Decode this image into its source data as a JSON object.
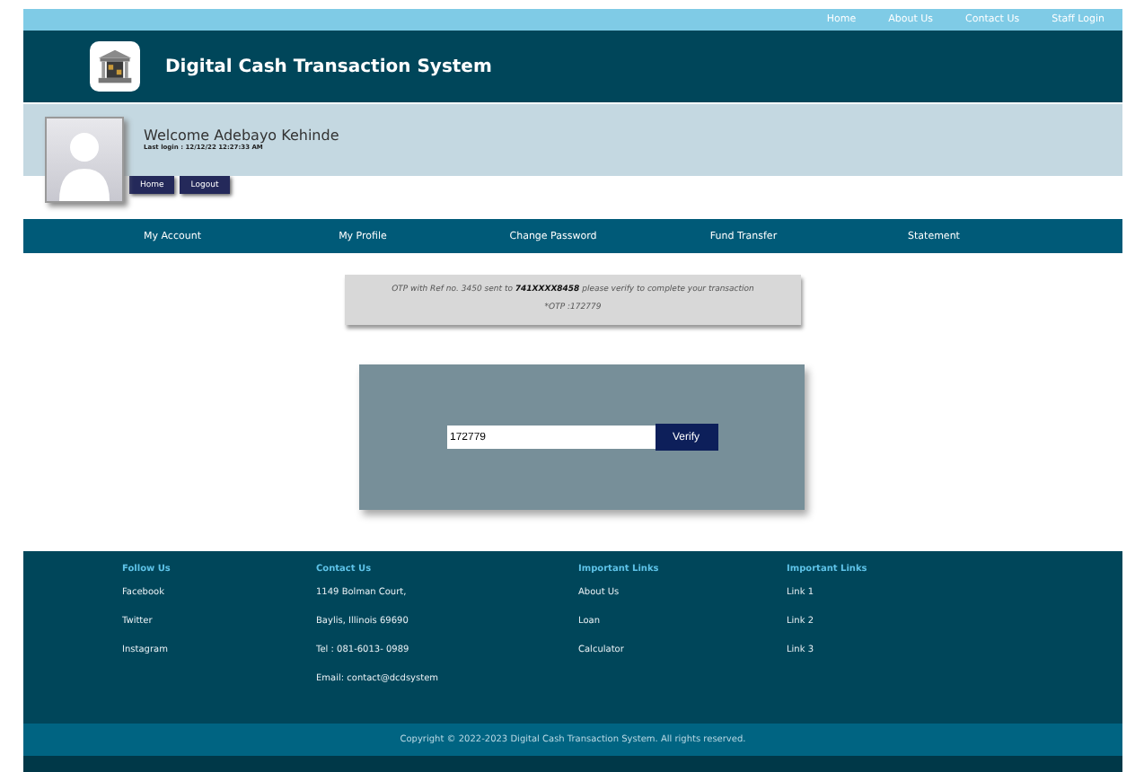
{
  "top_links": [
    "Home",
    "About Us",
    "Contact Us",
    "Staff Login"
  ],
  "header": {
    "title": "Digital Cash Transaction System"
  },
  "user": {
    "welcome": "Welcome  Adebayo  Kehinde",
    "last_login": "Last login : 12/12/22 12:27:33 AM",
    "buttons": [
      "Home",
      "Logout"
    ]
  },
  "nav": [
    "My Account",
    "My Profile",
    "Change Password",
    "Fund Transfer",
    "Statement"
  ],
  "otp_message": {
    "text": "OTP with Ref no. 3450 sent to **741XXXX8458** please verify to complete your transaction",
    "otp": "*OTP :172779"
  },
  "verify_form": {
    "value": "172779",
    "button": "Verify"
  },
  "footer": {
    "columns": [
      {
        "heading": "Follow Us",
        "items": [
          "Facebook",
          "Twitter",
          "Instagram"
        ]
      },
      {
        "heading": "Contact Us",
        "items": [
          "1149 Bolman Court,",
          "Baylis, Illinois 69690",
          "Tel : 081-6013- 0989",
          "Email: contact@dcdsystem"
        ]
      },
      {
        "heading": "Important Links",
        "items": [
          "About Us",
          "Loan",
          "Calculator"
        ]
      },
      {
        "heading": "Important Links",
        "items": [
          "Link 1",
          "Link 2",
          "Link 3"
        ]
      }
    ],
    "copyright": "Copyright © 2022-2023 Digital Cash Transaction System. All rights reserved."
  }
}
